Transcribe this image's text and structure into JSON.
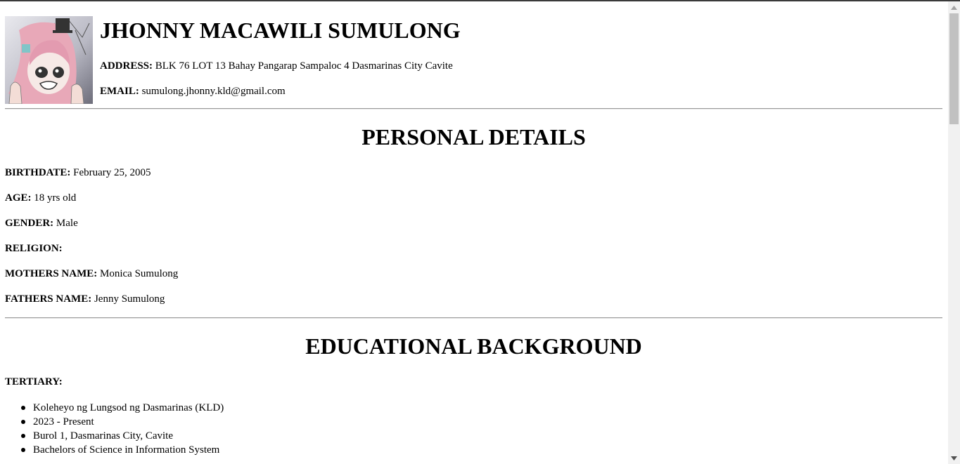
{
  "resume": {
    "name": "JHONNY MACAWILI SUMULONG",
    "address_label": "ADDRESS:",
    "address": "BLK 76 LOT 13 Bahay Pangarap Sampaloc 4 Dasmarinas City Cavite",
    "email_label": "EMAIL:",
    "email": "sumulong.jhonny.kld@gmail.com"
  },
  "personal": {
    "title": "PERSONAL DETAILS",
    "fields": [
      {
        "label": "BIRTHDATE:",
        "value": "February 25, 2005"
      },
      {
        "label": "AGE:",
        "value": "18 yrs old"
      },
      {
        "label": "GENDER:",
        "value": "Male"
      },
      {
        "label": "RELIGION:",
        "value": ""
      },
      {
        "label": "MOTHERS NAME:",
        "value": "Monica Sumulong"
      },
      {
        "label": "FATHERS NAME:",
        "value": "Jenny Sumulong"
      }
    ]
  },
  "education": {
    "title": "EDUCATIONAL BACKGROUND",
    "tertiary_label": "TERTIARY:",
    "tertiary_items": [
      "Koleheyo ng Lungsod ng Dasmarinas (KLD)",
      "2023 - Present",
      "Burol 1, Dasmarinas City, Cavite",
      "Bachelors of Science in Information System"
    ]
  },
  "colors": {
    "text": "#000000",
    "rule": "#9a9a9a",
    "scroll_thumb": "#c1c1c1",
    "scroll_track": "#f1f1f1"
  },
  "icons": {
    "avatar": "anime-profile-picture",
    "scroll_up": "triangle-up-icon",
    "scroll_down": "triangle-down-icon"
  }
}
